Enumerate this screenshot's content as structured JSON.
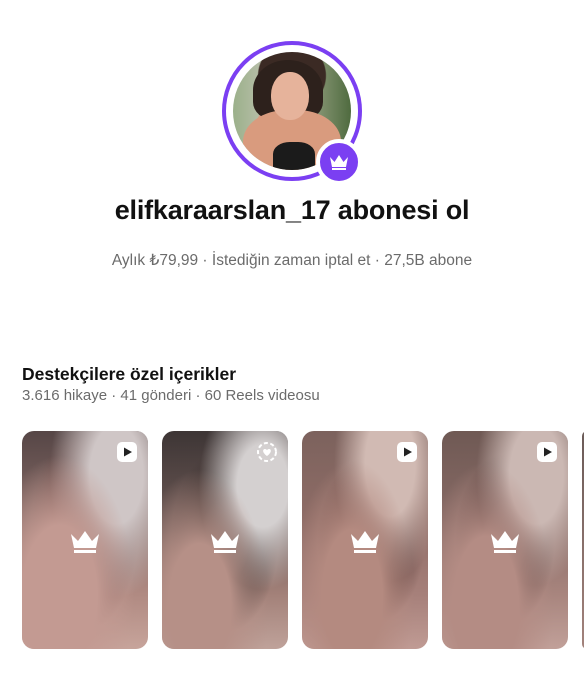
{
  "profile": {
    "title": "elifkaraarslan_17 abonesi ol",
    "subtitle": "Aylık ₺79,99 · İstediğin zaman iptal et · 27,5B abone"
  },
  "exclusive": {
    "title": "Destekçilere özel içerikler",
    "stats": "3.616 hikaye · 41 gönderi · 60 Reels videosu",
    "tiles": [
      {
        "type_icon": "reels-play-icon",
        "overlay_icon": "crown-icon"
      },
      {
        "type_icon": "story-heart-icon",
        "overlay_icon": "crown-icon"
      },
      {
        "type_icon": "reels-play-icon",
        "overlay_icon": "crown-icon"
      },
      {
        "type_icon": "reels-play-icon",
        "overlay_icon": "crown-icon"
      }
    ]
  },
  "colors": {
    "accent": "#7b3ff2",
    "muted_text": "#6b6b6b"
  }
}
